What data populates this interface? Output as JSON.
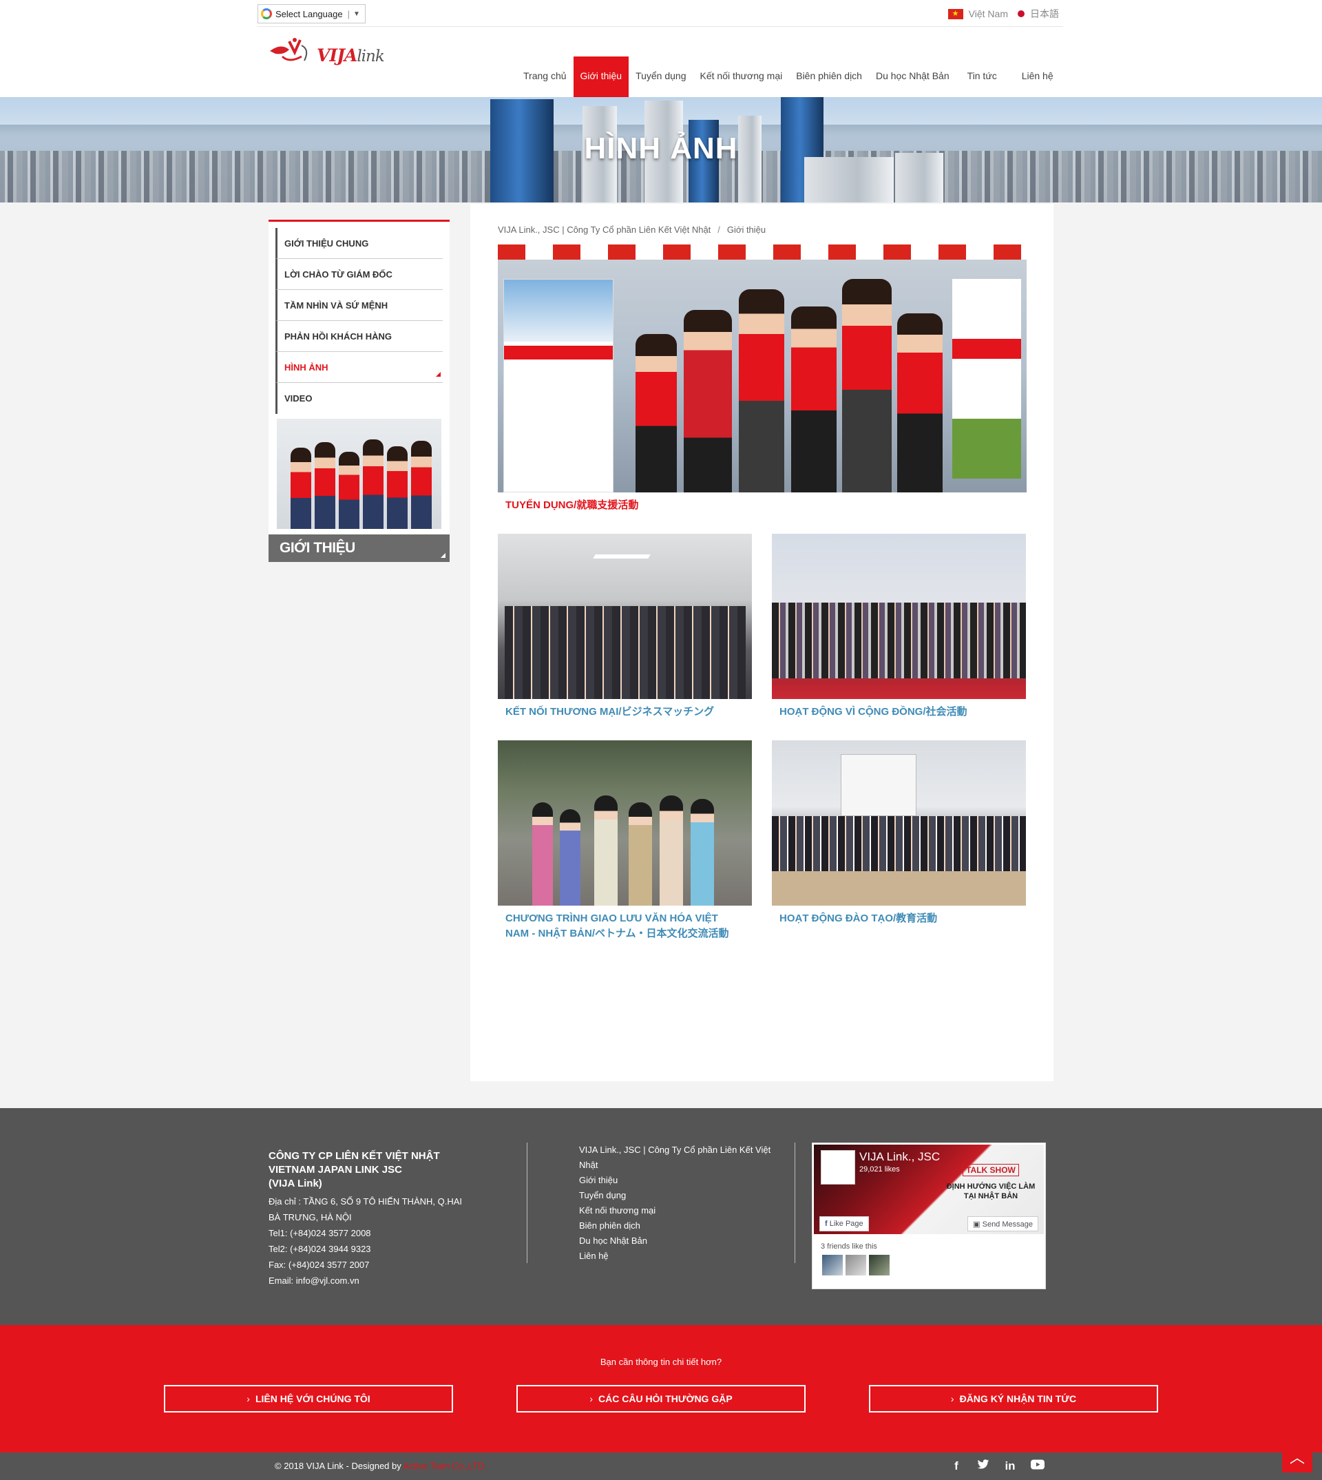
{
  "topbar": {
    "language_select": "Select Language",
    "region_vietnam": "Việt Nam",
    "region_japan": "日本語"
  },
  "logo": {
    "brand": "VIJA",
    "suffix": "link"
  },
  "nav": [
    {
      "label": "Trang chủ"
    },
    {
      "label": "Giới thiệu"
    },
    {
      "label": "Tuyển dụng"
    },
    {
      "label": "Kết nối thương mại"
    },
    {
      "label": "Biên phiên dịch"
    },
    {
      "label": "Du học Nhật Bản"
    },
    {
      "label": "Tin tức"
    },
    {
      "label": "Liên hệ"
    }
  ],
  "banner": {
    "title": "HÌNH ẢNH"
  },
  "sidebar": {
    "items": [
      {
        "label": "GIỚI THIỆU CHUNG"
      },
      {
        "label": "LỜI CHÀO TỪ GIÁM ĐỐC"
      },
      {
        "label": "TẦM NHÌN VÀ SỨ MỆNH"
      },
      {
        "label": "PHẢN HỒI KHÁCH HÀNG"
      },
      {
        "label": "HÌNH ẢNH"
      },
      {
        "label": "VIDEO"
      }
    ],
    "footer_title": "GIỚI THIỆU"
  },
  "breadcrumb": {
    "home": "VIJA Link., JSC | Công Ty Cổ phần Liên Kết Việt Nhật",
    "current": "Giới thiệu"
  },
  "gallery": [
    {
      "caption": "TUYỂN DỤNG/就職支援活動"
    },
    {
      "caption": "KẾT NỐI THƯƠNG MẠI/ビジネスマッチング"
    },
    {
      "caption": "HOẠT ĐỘNG VÌ CỘNG ĐỒNG/社会活動"
    },
    {
      "caption": "CHƯƠNG TRÌNH GIAO LƯU VĂN HÓA VIỆT NAM - NHẬT BẢN/ベトナム・日本文化交流活動"
    },
    {
      "caption": "HOẠT ĐỘNG ĐÀO TẠO/教育活動"
    }
  ],
  "footer": {
    "company_lines": [
      "CÔNG TY CP LIÊN KẾT VIỆT NHẬT",
      "VIETNAM JAPAN LINK JSC",
      "(VIJA Link)"
    ],
    "address": "Địa chỉ : TẦNG 6, SỐ 9 TÔ HIẾN THÀNH, Q.HAI BÀ TRƯNG, HÀ NỘI",
    "tel1": "Tel1: (+84)024 3577 2008",
    "tel2": "Tel2: (+84)024 3944 9323",
    "fax": "Fax: (+84)024 3577 2007",
    "email": "Email: info@vjl.com.vn",
    "links": [
      {
        "label": "VIJA Link., JSC | Công Ty Cổ phần Liên Kết Việt Nhật"
      },
      {
        "label": "Giới thiệu"
      },
      {
        "label": "Tuyển dụng"
      },
      {
        "label": "Kết nối thương mại"
      },
      {
        "label": "Biên phiên dịch"
      },
      {
        "label": "Du học Nhật Bản"
      },
      {
        "label": "Liên hệ"
      }
    ],
    "facebook": {
      "page_name": "VIJA Link., JSC",
      "likes": "29,021 likes",
      "like_button": "Like Page",
      "message_button": "Send Message",
      "friends": "3 friends like this",
      "cover_badge": "TALK SHOW",
      "cover_title": "ĐỊNH HƯỚNG VIỆC LÀM TẠI NHẬT BẢN"
    }
  },
  "cta": {
    "question": "Bạn cần thông tin chi tiết hơn?",
    "buttons": [
      {
        "label": "LIÊN HỆ VỚI CHÚNG TÔI"
      },
      {
        "label": "CÁC CÂU HỎI THƯỜNG GẶP"
      },
      {
        "label": "ĐĂNG KÝ NHẬN TIN TỨC"
      }
    ]
  },
  "bottom": {
    "copyright": "© 2018 VIJA Link - Designed by",
    "designer": "Active Tiam Co.,LTD"
  },
  "social_icons": [
    "facebook-icon",
    "twitter-icon",
    "linkedin-icon",
    "youtube-icon"
  ],
  "colors": {
    "accent": "#e3141b",
    "footer_bg": "#555555",
    "caption_blue": "#3f8bb6"
  }
}
